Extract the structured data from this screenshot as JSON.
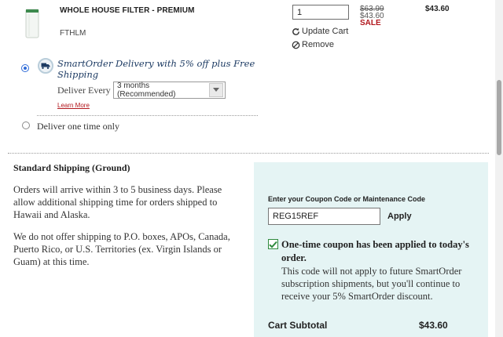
{
  "product": {
    "name": "WHOLE HOUSE FILTER - PREMIUM",
    "sku": "FTHLM",
    "quantity": "1",
    "update_label": "Update Cart",
    "remove_label": "Remove",
    "price_original": "$63.99",
    "price_current": "$43.60",
    "sale_label": "SALE",
    "line_total": "$43.60"
  },
  "delivery": {
    "smartorder_label": "SmartOrder Delivery with 5% off plus Free Shipping",
    "smartorder_selected": true,
    "deliver_every_label": "Deliver Every",
    "frequency_value": "3 months (Recommended)",
    "learn_more_label": "Learn More",
    "one_time_label": "Deliver one time only",
    "one_time_selected": false
  },
  "shipping": {
    "title": "Standard Shipping (Ground)",
    "text_1": "Orders will arrive within 3 to 5 business days. Please allow additional shipping time for orders shipped to Hawaii and Alaska.",
    "text_2": "We do not offer shipping to P.O. boxes, APOs, Canada, Puerto Rico, or U.S. Territories (ex. Virgin Islands or Guam) at this time."
  },
  "coupon": {
    "label": "Enter your Coupon Code or Maintenance Code",
    "code_value": "REG15REF",
    "apply_label": "Apply",
    "applied_title": "One-time coupon has been applied to today's order.",
    "applied_note": "This code will not apply to future SmartOrder subscription shipments, but you'll continue to receive your 5% SmartOrder discount."
  },
  "summary": {
    "subtotal_label": "Cart Subtotal",
    "subtotal_value": "$43.60"
  },
  "colors": {
    "sale_red": "#b2171d",
    "coupon_panel": "#e5f4f4",
    "smartorder_blue": "#1d3b63",
    "check_green": "#2e8a3d"
  },
  "icons": {
    "update": "refresh-icon",
    "remove": "remove-circle-icon",
    "smartorder": "truck-icon",
    "select": "chevron-down-icon",
    "applied": "checkmark-icon"
  }
}
